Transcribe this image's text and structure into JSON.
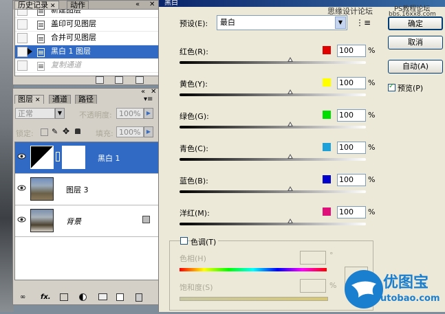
{
  "history": {
    "tabs": [
      "历史记录",
      "动作"
    ],
    "items": [
      {
        "label": "新建图层",
        "state": "normal"
      },
      {
        "label": "盖印可见图层",
        "state": "normal"
      },
      {
        "label": "合并可见图层",
        "state": "normal"
      },
      {
        "label": "黑白 1 图层",
        "state": "selected"
      },
      {
        "label": "复制通道",
        "state": "ghost"
      }
    ]
  },
  "layers_panel": {
    "tabs": [
      "图层",
      "通道",
      "路径"
    ],
    "blend_mode": "正常",
    "opacity_label": "不透明度:",
    "opacity_value": "100%",
    "lock_label": "锁定:",
    "fill_label": "填充:",
    "fill_value": "100%",
    "layers": [
      {
        "name": "黑白 1",
        "selected": true
      },
      {
        "name": "图层 3",
        "selected": false
      },
      {
        "name": "背景",
        "selected": false,
        "locked": true
      }
    ],
    "footer_icons": [
      "link-icon",
      "fx-icon",
      "mask-icon",
      "adjustment-icon",
      "folder-icon",
      "new-layer-icon",
      "trash-icon"
    ]
  },
  "dialog": {
    "title": "黑白",
    "watermark_top": "思缘设计论坛",
    "watermark_right": "PS教程论坛",
    "watermark_url": "bbs.16xx8.com",
    "preset_label": "预设(E):",
    "preset_value": "最白",
    "ok_label": "确定",
    "cancel_label": "取消",
    "auto_label": "自动(A)",
    "preview_label": "预览(P)",
    "preview_checked": true,
    "sliders": [
      {
        "label": "红色(R):",
        "value": "100",
        "color": "#e00000",
        "track_start": "#000000",
        "track_end": "#ffffff"
      },
      {
        "label": "黄色(Y):",
        "value": "100",
        "color": "#ffff00",
        "track_start": "#000000",
        "track_end": "#ffffff"
      },
      {
        "label": "绿色(G):",
        "value": "100",
        "color": "#00dd00",
        "track_start": "#000000",
        "track_end": "#ffffff"
      },
      {
        "label": "青色(C):",
        "value": "100",
        "color": "#1ea0d8",
        "track_start": "#000000",
        "track_end": "#ffffff"
      },
      {
        "label": "蓝色(B):",
        "value": "100",
        "color": "#0000cc",
        "track_start": "#000000",
        "track_end": "#ffffff"
      },
      {
        "label": "洋红(M):",
        "value": "100",
        "color": "#e0107a",
        "track_start": "#000000",
        "track_end": "#ffffff"
      }
    ],
    "percent": "%",
    "tint_label": "色调(T)",
    "hue_label": "色相(H)",
    "hue_unit": "°",
    "saturation_label": "饱和度(S)",
    "saturation_unit": "%"
  },
  "logo": {
    "text": "优图宝",
    "url": "utobao.com",
    "color": "#1b7fd0"
  }
}
